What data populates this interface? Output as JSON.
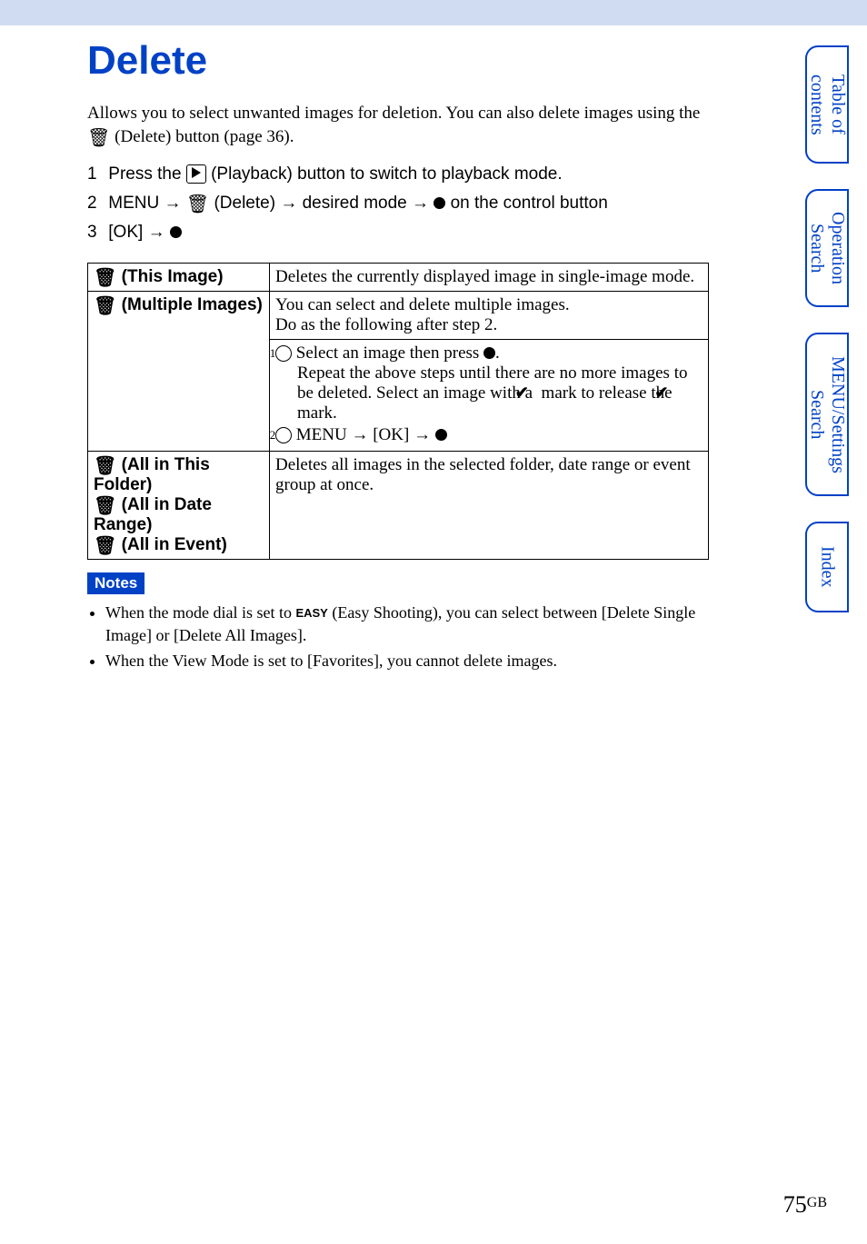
{
  "title": "Delete",
  "intro_line1": "Allows you to select unwanted images for deletion. You can also delete images using the",
  "intro_line2": " (Delete) button (page 36).",
  "steps": {
    "s1_prefix": "Press the ",
    "s1_suffix": " (Playback) button to switch to playback mode.",
    "s2_a": "MENU ",
    "s2_b": " (Delete) ",
    "s2_c": " desired mode ",
    "s2_d": " on the control button",
    "s3_a": "[OK] "
  },
  "table": {
    "r1_label": " (This Image)",
    "r1_desc": "Deletes the currently displayed image in single-image mode.",
    "r2_label": " (Multiple Images)",
    "r2_top1": "You can select and delete multiple images.",
    "r2_top2": "Do as the following after step 2.",
    "r2_b1a": "Select an image then press ",
    "r2_b1b": ".",
    "r2_b1c": "Repeat the above steps until there are no more images to be deleted. Select an image with a ",
    "r2_b1d": " mark to release the ",
    "r2_b1e": " mark.",
    "r2_b2a": "MENU ",
    "r2_b2b": " [OK] ",
    "r3_l1": " (All in This Folder)",
    "r3_l2": " (All in Date Range)",
    "r3_l3": " (All in Event)",
    "r3_desc": "Deletes all images in the selected folder, date range or event group at once."
  },
  "notes": {
    "heading": "Notes",
    "n1a": "When the mode dial is set to ",
    "n1_easy": "EASY",
    "n1b": " (Easy Shooting), you can select between [Delete Single Image] or [Delete All Images].",
    "n2": "When the View Mode is set to [Favorites], you cannot delete images."
  },
  "tabs": {
    "t1": "Table of contents",
    "t2": "Operation Search",
    "t3": "MENU/Settings Search",
    "t4": "Index"
  },
  "page": {
    "num": "75",
    "suffix": "GB"
  }
}
